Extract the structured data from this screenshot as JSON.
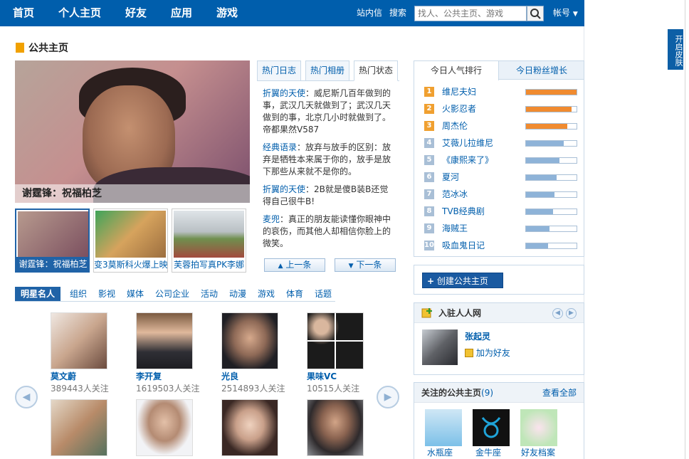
{
  "nav": {
    "items": [
      "首页",
      "个人主页",
      "好友",
      "应用",
      "游戏"
    ],
    "inbox": "站内信",
    "search_label": "搜索",
    "search_placeholder": "找人、公共主页、游戏",
    "account": "帐号"
  },
  "skin": "开启皮肤",
  "page_title": "公共主页",
  "hero": {
    "caption": "谢霆锋：祝福柏芝"
  },
  "thumbs": [
    {
      "label": "谢霆锋：祝福柏芝",
      "active": true
    },
    {
      "label": "变3莫斯科火爆上映",
      "active": false
    },
    {
      "label": "芙蓉拍写真PK李娜",
      "active": false
    }
  ],
  "hot_tabs": [
    "热门日志",
    "热门相册",
    "热门状态"
  ],
  "feed": [
    {
      "who": "折翼的天使",
      "text": "：威尼斯几百年做到的事，武汉几天就做到了；武汉几天做到的事，北京几小时就做到了。帝都果然V587"
    },
    {
      "who": "经典语录",
      "text": "：放弃与放手的区别：放弃是牺牲本来属于你的，放手是放下那些从来就不是你的。"
    },
    {
      "who": "折翼的天使",
      "text": "：2B就是傻B装B还觉得自己很牛B!"
    },
    {
      "who": "麦兜",
      "text": "：真正的朋友能读懂你眼神中的哀伤，而其他人却相信你脸上的微笑。"
    }
  ],
  "pager": {
    "prev": "上一条",
    "next": "下一条"
  },
  "categories": [
    "明星名人",
    "组织",
    "影视",
    "媒体",
    "公司企业",
    "活动",
    "动漫",
    "游戏",
    "体育",
    "话题"
  ],
  "celebs": [
    {
      "name": "莫文蔚",
      "fans": "389443人关注"
    },
    {
      "name": "李开复",
      "fans": "1619503人关注"
    },
    {
      "name": "光良",
      "fans": "2514893人关注"
    },
    {
      "name": "果味VC",
      "fans": "10515人关注"
    }
  ],
  "rank": {
    "tabs": [
      "今日人气排行",
      "今日粉丝增长"
    ],
    "items": [
      {
        "n": "1",
        "name": "维尼夫妇",
        "level": 1.0
      },
      {
        "n": "2",
        "name": "火影忍者",
        "level": 0.9
      },
      {
        "n": "3",
        "name": "周杰伦",
        "level": 0.82
      },
      {
        "n": "4",
        "name": "艾薇儿拉维尼",
        "level": 0.74
      },
      {
        "n": "5",
        "name": "《康熙来了》",
        "level": 0.66
      },
      {
        "n": "6",
        "name": "夏河",
        "level": 0.6
      },
      {
        "n": "7",
        "name": "范冰冰",
        "level": 0.57
      },
      {
        "n": "8",
        "name": "TVB经典剧",
        "level": 0.54
      },
      {
        "n": "9",
        "name": "海贼王",
        "level": 0.47
      },
      {
        "n": "10",
        "name": "吸血鬼日记",
        "level": 0.44
      }
    ],
    "colors": {
      "top": "#f08b30",
      "rest": "#8eb3d8",
      "badge_top": "#f0a030",
      "badge_rest": "#a9bfd6"
    }
  },
  "create_button": "创建公共主页",
  "join": {
    "title": "入驻人人网",
    "person": "张起灵",
    "add_friend": "加为好友"
  },
  "followed": {
    "title": "关注的公共主页",
    "count": "(9)",
    "view_all": "查看全部",
    "items": [
      "水瓶座",
      "金牛座",
      "好友档案"
    ]
  }
}
